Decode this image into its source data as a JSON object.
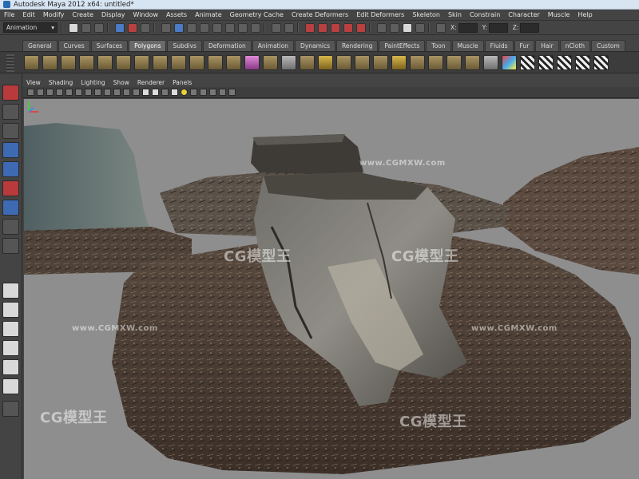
{
  "window": {
    "title": "Autodesk Maya 2012 x64: untitled*"
  },
  "menu": [
    "File",
    "Edit",
    "Modify",
    "Create",
    "Display",
    "Window",
    "Assets",
    "Animate",
    "Geometry Cache",
    "Create Deformers",
    "Edit Deformers",
    "Skeleton",
    "Skin",
    "Constrain",
    "Character",
    "Muscle",
    "Help"
  ],
  "statusline": {
    "mode": "Animation",
    "x_label": "X:",
    "y_label": "Y:",
    "z_label": "Z:"
  },
  "shelf_tabs": [
    "General",
    "Curves",
    "Surfaces",
    "Polygons",
    "Subdivs",
    "Deformation",
    "Animation",
    "Dynamics",
    "Rendering",
    "PaintEffects",
    "Toon",
    "Muscle",
    "Fluids",
    "Fur",
    "Hair",
    "nCloth",
    "Custom"
  ],
  "active_shelf_tab": "Polygons",
  "panel_menu": [
    "View",
    "Shading",
    "Lighting",
    "Show",
    "Renderer",
    "Panels"
  ],
  "watermarks": [
    "CG模型王",
    "www.CGMXW.com"
  ],
  "colors": {
    "bg": "#444444",
    "viewport": "#8e8e8e",
    "active_tab": "#6a6a6a",
    "select_tool": "#b83a3a"
  }
}
